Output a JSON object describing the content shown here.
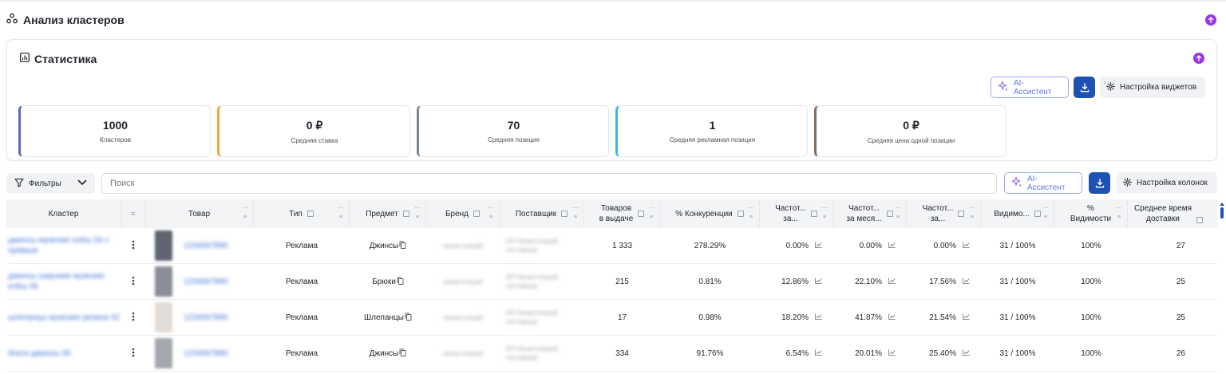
{
  "page": {
    "title": "Анализ кластеров"
  },
  "statistics": {
    "title": "Статистика",
    "ai_button": "AI-Ассистент",
    "widgets_button": "Настройка виджетов",
    "kpis": [
      {
        "value": "1000",
        "label": "Кластеров",
        "color": "#5b6bb5"
      },
      {
        "value": "0 ₽",
        "label": "Средняя ставка",
        "color": "#f2a441"
      },
      {
        "value": "70",
        "label": "Средняя позиция",
        "color": "#7b8694"
      },
      {
        "value": "1",
        "label": "Средняя рекламная позиция",
        "color": "#3fb4e8"
      },
      {
        "value": "0 ₽",
        "label": "Средняя цена одной позиции",
        "color": "#8a6a5b"
      }
    ]
  },
  "toolbar": {
    "filters_label": "Фильтры",
    "search_placeholder": "Поиск",
    "ai_button": "AI-Ассистент",
    "columns_button": "Настройка колонок"
  },
  "table": {
    "headers": {
      "cluster": "Кластер",
      "product": "Товар",
      "type": "Тип",
      "subject": "Предмет",
      "brand": "Бренд",
      "supplier": "Поставщик",
      "goods_1": "Товаров",
      "goods_2": "в выдаче",
      "competition": "% Конкуренции",
      "freq1_1": "Частот...",
      "freq1_2": "за...",
      "freq2_1": "Частот...",
      "freq2_2": "за меся...",
      "freq3_1": "Частот...",
      "freq3_2": "за...",
      "visibility": "Видимо...",
      "pct_vis_1": "%",
      "pct_vis_2": "Видимости",
      "delivery_1": "Среднее время",
      "delivery_2": "доставки"
    },
    "rows": [
      {
        "cluster": "джинсы мужские клёш 34 с прямым",
        "product": "1234567890",
        "type": "Реклама",
        "subject": "Джинсы",
        "brand": "ненастоящий",
        "supplier": "ИП Ненастоящий поставщик",
        "goods": "1 333",
        "competition": "278.29%",
        "f1": "0.00%",
        "f2": "0.00%",
        "f3": "0.00%",
        "visibility": "31 / 100%",
        "pct_vis": "100%",
        "delivery": "27",
        "thumb": "#5e6470"
      },
      {
        "cluster": "джинсы широкие мужские клёш 36",
        "product": "1234567890",
        "type": "Реклама",
        "subject": "Брюки",
        "brand": "ненастоящий",
        "supplier": "ИП Ненастоящий поставщик",
        "goods": "215",
        "competition": "0.81%",
        "f1": "12.86%",
        "f2": "22.10%",
        "f3": "17.56%",
        "visibility": "31 / 100%",
        "pct_vis": "100%",
        "delivery": "25",
        "thumb": "#8a8e96"
      },
      {
        "cluster": "шлепанцы мужские резина 42",
        "product": "1234567890",
        "type": "Реклама",
        "subject": "Шлепанцы",
        "brand": "ненастоящий",
        "supplier": "ИП Ненастоящий поставщик",
        "goods": "17",
        "competition": "0.98%",
        "f1": "18.20%",
        "f2": "41.87%",
        "f3": "21.54%",
        "visibility": "31 / 100%",
        "pct_vis": "100%",
        "delivery": "25",
        "thumb": "#e3dcd6"
      },
      {
        "cluster": "блеск джинсы 36",
        "product": "1234567890",
        "type": "Реклама",
        "subject": "Джинсы",
        "brand": "ненастоящий",
        "supplier": "ИП Ненастоящий поставщик",
        "goods": "334",
        "competition": "91.76%",
        "f1": "6.54%",
        "f2": "20.01%",
        "f3": "25.40%",
        "visibility": "31 / 100%",
        "pct_vis": "100%",
        "delivery": "26",
        "thumb": "#a4a7ad"
      }
    ]
  },
  "colors": {
    "accent_purple": "#9b36e6",
    "download_blue": "#1d52b4",
    "ai_border": "#9aa9e8"
  },
  "icons": [
    "cluster-icon",
    "arrow-up-icon",
    "chart-icon",
    "sparkle-icon",
    "download-icon",
    "gear-icon",
    "filter-icon",
    "chevron-down-icon",
    "copy-icon",
    "trend-icon",
    "kebab-icon"
  ]
}
